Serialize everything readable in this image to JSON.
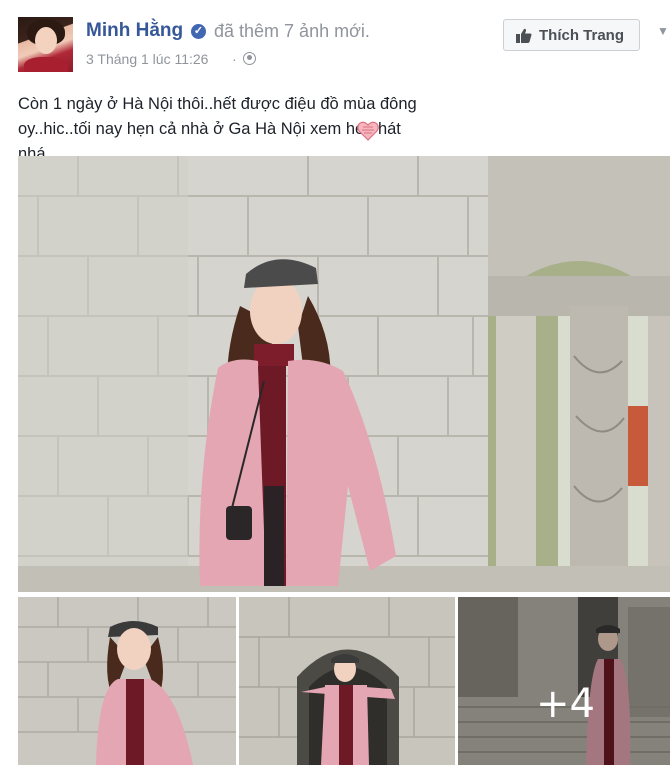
{
  "post": {
    "author": "Minh Hằng",
    "action": "đã thêm 7 ảnh mới.",
    "timestamp": "3 Tháng 1 lúc 11:26",
    "separator": "·",
    "privacy_icon": "globe-icon",
    "verified_icon": "verified-badge-icon",
    "verified_glyph": "✓",
    "like_page_label": "Thích Trang",
    "menu_glyph": "▼",
    "text": "Còn 1 ngày ở Hà Nội thôi..hết được điệu đồ mùa đông oy..hic..tối nay hẹn cả nhà ở Ga Hà Nội xem heo hát nhá...",
    "emoji_icon": "heart-icon",
    "photos": {
      "more_count_label": "+4"
    }
  },
  "colors": {
    "author_link": "#365899",
    "meta_text": "#90949c",
    "coat_pink": "#e3a6b2"
  }
}
